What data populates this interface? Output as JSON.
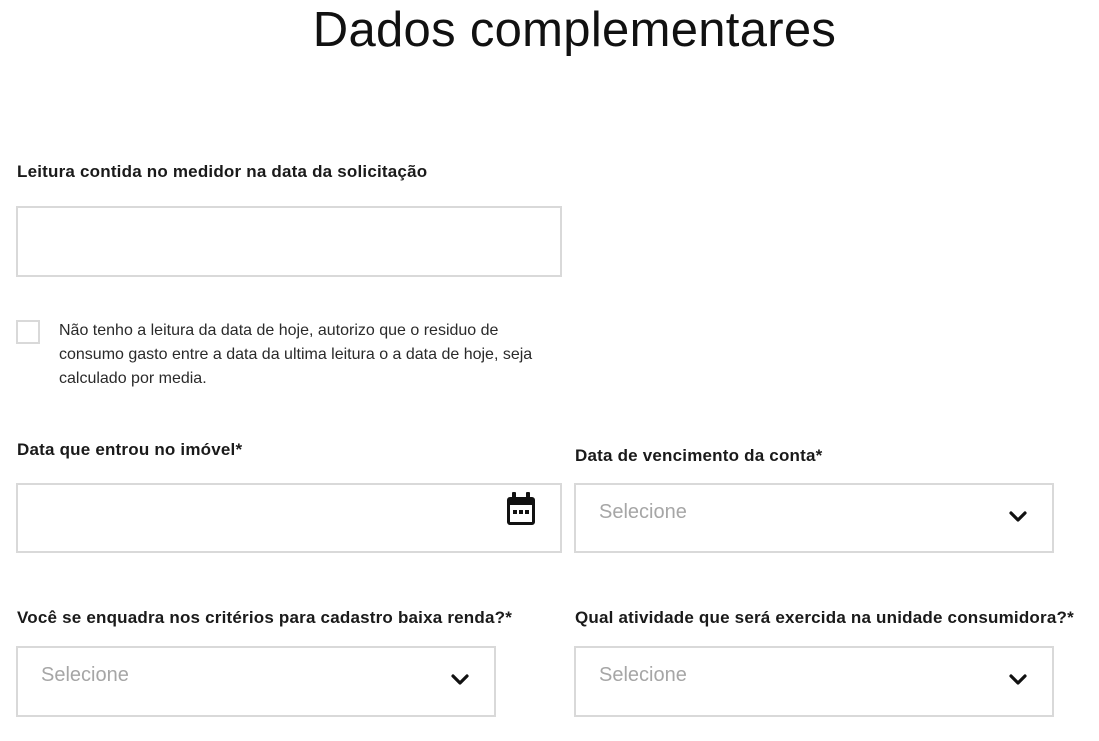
{
  "page": {
    "title": "Dados complementares"
  },
  "meter_reading": {
    "label": "Leitura contida no medidor na data da solicitação",
    "value": ""
  },
  "no_reading_checkbox": {
    "checked": false,
    "text": "Não tenho a leitura da data de hoje, autorizo que o residuo de consumo gasto entre a data da ultima leitura o a data de hoje, seja calculado por media."
  },
  "move_in_date": {
    "label": "Data que entrou no imóvel*",
    "value": "",
    "icon": "calendar-icon"
  },
  "due_date": {
    "label": "Data de vencimento da conta*",
    "placeholder": "Selecione",
    "icon": "chevron-down-icon"
  },
  "low_income": {
    "label": "Você se enquadra nos critérios para cadastro baixa renda?*",
    "placeholder": "Selecione",
    "icon": "chevron-down-icon"
  },
  "activity": {
    "label": "Qual atividade que será exercida na unidade consumidora?*",
    "placeholder": "Selecione",
    "icon": "chevron-down-icon"
  },
  "colors": {
    "border": "#d9d9d9",
    "placeholder": "#a6a6a6",
    "text": "#1a1a1a"
  }
}
